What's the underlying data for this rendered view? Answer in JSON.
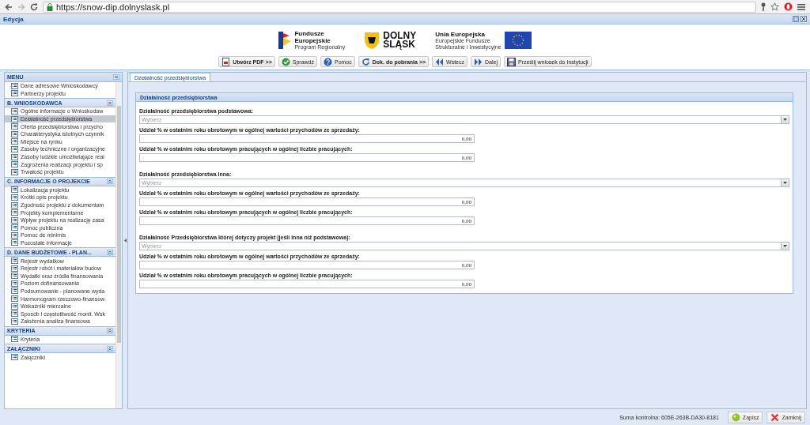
{
  "browser": {
    "url": "https://snow-dip.dolnyslask.pl"
  },
  "app": {
    "title": "Edycja"
  },
  "header": {
    "logos": [
      {
        "kind": "fe",
        "title": [
          "Fundusze",
          "Europejskie"
        ],
        "subtitle": [
          "Program Regionalny"
        ]
      },
      {
        "kind": "ds",
        "title": [
          "DOLNY",
          "ŚLĄSK"
        ]
      },
      {
        "kind": "ue",
        "title": [
          "Unia Europejska"
        ],
        "subtitle": [
          "Europejskie Fundusze",
          "Strukturalne i Inwestycyjne"
        ]
      }
    ],
    "toolbar": [
      {
        "label": "Utwórz PDF >>",
        "bold": true
      },
      {
        "label": "Sprawdź",
        "bold": false
      },
      {
        "label": "Pomoc",
        "bold": false
      },
      {
        "label": "Dok. do pobrania >>",
        "bold": true
      },
      {
        "label": "Wstecz",
        "bold": false
      },
      {
        "label": "Dalej",
        "bold": false
      },
      {
        "label": "Prześlij wniosek do Instytucji",
        "bold": false
      }
    ]
  },
  "sidebar": {
    "title": "MENU",
    "sections": [
      {
        "items": [
          {
            "label": "Dane adresowe Wnioskodawcy",
            "selected": false
          },
          {
            "label": "Partnerzy projektu",
            "selected": false
          }
        ]
      },
      {
        "title": "B. WNIOSKODAWCA",
        "items": [
          {
            "label": "Ogólne informacje o Wnioskodaw",
            "selected": false
          },
          {
            "label": "Działalność przedsiębiorstwa",
            "selected": true
          },
          {
            "label": "Oferta przedsiębiorstwa i przycho",
            "selected": false
          },
          {
            "label": "Charakterystyka istotnych czynnik",
            "selected": false
          },
          {
            "label": "Miejsce na rynku",
            "selected": false
          },
          {
            "label": "Zasoby techniczne i organizacyjne",
            "selected": false
          },
          {
            "label": "Zasoby ludzkie umożliwiające real",
            "selected": false
          },
          {
            "label": "Zagrożenia realizacji projektu i sp",
            "selected": false
          },
          {
            "label": "Trwałość projektu",
            "selected": false
          }
        ]
      },
      {
        "title": "C. INFORMACJE O PROJEKCIE",
        "items": [
          {
            "label": "Lokalizacja projektu",
            "selected": false
          },
          {
            "label": "Krótki opis projektu",
            "selected": false
          },
          {
            "label": "Zgodność projektu z dokumentam",
            "selected": false
          },
          {
            "label": "Projekty komplementarne",
            "selected": false
          },
          {
            "label": "Wpływ projektu na realizację zasa",
            "selected": false
          },
          {
            "label": "Pomoc publiczna",
            "selected": false
          },
          {
            "label": "Pomoc de minimis",
            "selected": false
          },
          {
            "label": "Pozostałe informacje",
            "selected": false
          }
        ]
      },
      {
        "title": "D. DANE BUDŻETOWE - PLAN...",
        "items": [
          {
            "label": "Rejestr wydatków",
            "selected": false
          },
          {
            "label": "Rejestr robót i materiałów budow",
            "selected": false
          },
          {
            "label": "Wydatki oraz źródła finansowania",
            "selected": false
          },
          {
            "label": "Poziom dofinansowania",
            "selected": false
          },
          {
            "label": "Podsumowanie - planowane wyda",
            "selected": false
          },
          {
            "label": "Harmonogram rzeczowo-finansow",
            "selected": false
          },
          {
            "label": "Wskaźniki mierzalne",
            "selected": false
          },
          {
            "label": "Sposób i częstotliwość monit. Wsk",
            "selected": false
          },
          {
            "label": "Założenia analiza finansowa",
            "selected": false
          }
        ]
      },
      {
        "title": "KRYTERIA",
        "items": [
          {
            "label": "Kryteria",
            "selected": false
          }
        ]
      },
      {
        "title": "ZAŁĄCZNIKI",
        "items": [
          {
            "label": "Załączniki",
            "selected": false
          }
        ]
      }
    ]
  },
  "tabs": [
    {
      "label": "Działalność przedsiębiorstwa",
      "selected": true
    }
  ],
  "form": {
    "title": "Działalność przedsiębiorstwa",
    "fields": [
      {
        "kind": "select",
        "label": "Działalność przedsiębiorstwa podstawowa:",
        "placeholder": "Wybierz"
      },
      {
        "kind": "number",
        "label": "Udział % w ostatnim roku obrotowym w ogólnej wartości przychodów ze sprzedaży:",
        "value": "0,00"
      },
      {
        "kind": "number",
        "label": "Udział % w ostatnim roku obrotowym pracujących w ogólnej liczbie pracujących:",
        "value": "0,00"
      },
      {
        "kind": "select",
        "label": "Działalność przedsiębiorstwa inna:",
        "placeholder": "Wybierz"
      },
      {
        "kind": "number",
        "label": "Udział % w ostatnim roku obrotowym w ogólnej wartości przychodów ze sprzedaży:",
        "value": "0,00"
      },
      {
        "kind": "number",
        "label": "Udział % w ostatnim roku obrotowym pracujących w ogólnej liczbie pracujących:",
        "value": "0,00"
      },
      {
        "kind": "select",
        "label": "Działalność Przedsiębiorstwa której dotyczy projekt (jeśli inna niż podstawowa):",
        "placeholder": "Wybierz"
      },
      {
        "kind": "number",
        "label": "Udział % w ostatnim roku obrotowym w ogólnej wartości przychodów ze sprzedaży:",
        "value": "0,00"
      },
      {
        "kind": "number",
        "label": "Udział % w ostatnim roku obrotowym pracujących w ogólnej liczbie pracujących:",
        "value": "0,00"
      }
    ]
  },
  "footer": {
    "checksum": "Suma kontrolna: 605E-263B-DA30-8181",
    "buttons": [
      {
        "label": "Zapisz"
      },
      {
        "label": "Zamknij"
      }
    ]
  }
}
